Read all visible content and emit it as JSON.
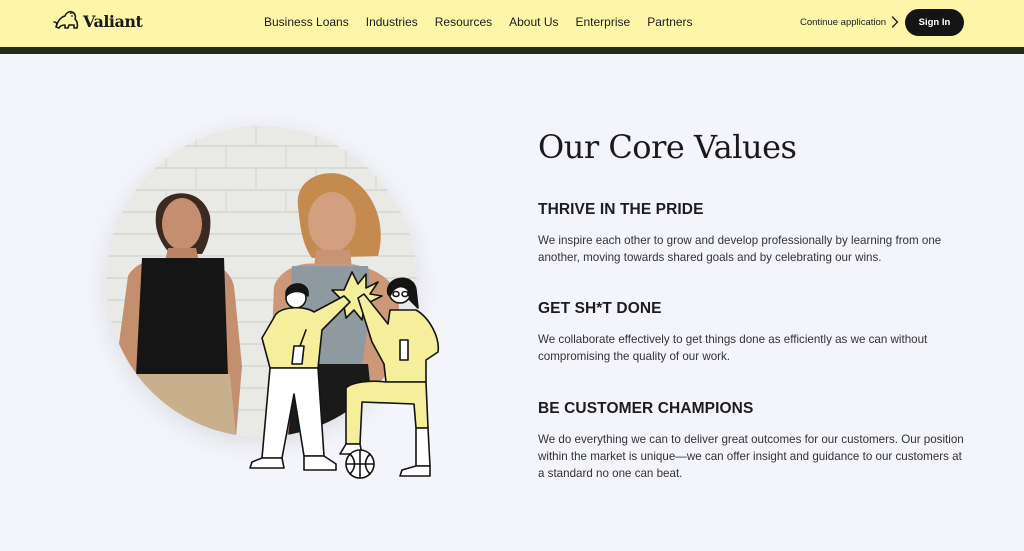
{
  "header": {
    "logo_text": "Valiant",
    "nav": [
      "Business Loans",
      "Industries",
      "Resources",
      "About Us",
      "Enterprise",
      "Partners"
    ],
    "continue_label": "Continue application",
    "signin_label": "Sign In"
  },
  "section": {
    "title": "Our Core Values",
    "values": [
      {
        "heading": "THRIVE IN THE PRIDE",
        "text": "We inspire each other to grow and develop professionally by learning from one another, moving towards shared goals and by celebrating our wins."
      },
      {
        "heading": "GET SH*T DONE",
        "text": "We collaborate effectively to get things done as efficiently as we can without compromising the quality of our work."
      },
      {
        "heading": "BE CUSTOMER CHAMPIONS",
        "text": "We do everything we can to deliver great outcomes for our customers. Our position within the market is unique—we can offer insight and guidance to our customers at a standard no one can beat."
      }
    ]
  },
  "colors": {
    "topbar": "#fdf6a8",
    "accent_yellow": "#f5ef9b",
    "page_bg": "#f4f4fb",
    "button_dark": "#141414"
  },
  "icons": [
    "lion-logo-icon",
    "chevron-right-icon"
  ]
}
